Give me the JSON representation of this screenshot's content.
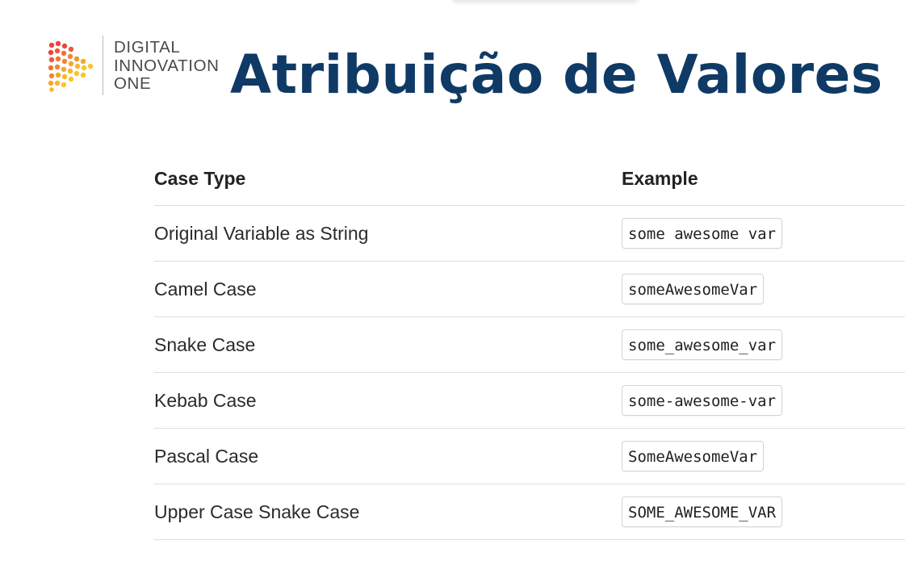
{
  "logo": {
    "lines": [
      "DIGITAL",
      "INNOVATION",
      "ONE"
    ]
  },
  "title": "Atribuição de Valores",
  "table": {
    "headers": [
      "Case Type",
      "Example"
    ],
    "rows": [
      {
        "type": "Original Variable as String",
        "example": "some awesome var"
      },
      {
        "type": "Camel Case",
        "example": "someAwesomeVar"
      },
      {
        "type": "Snake Case",
        "example": "some_awesome_var"
      },
      {
        "type": "Kebab Case",
        "example": "some-awesome-var"
      },
      {
        "type": "Pascal Case",
        "example": "SomeAwesomeVar"
      },
      {
        "type": "Upper Case Snake Case",
        "example": "SOME_AWESOME_VAR"
      }
    ]
  },
  "colors": {
    "title": "#0f3a66",
    "logo_red": "#e8453c",
    "logo_orange": "#f2922b",
    "logo_yellow": "#f8c62a"
  }
}
